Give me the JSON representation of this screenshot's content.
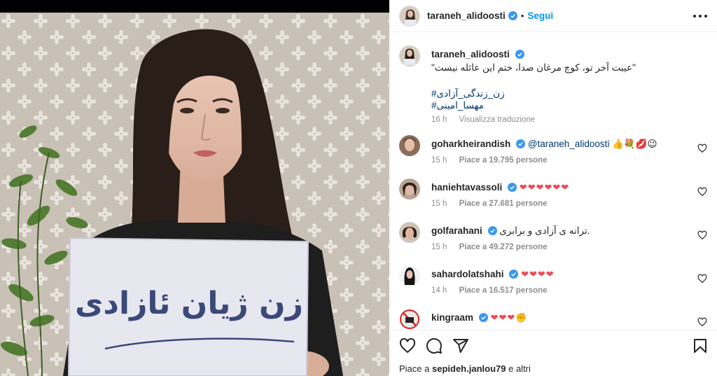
{
  "post": {
    "author": "taraneh_alidoosti",
    "follow_label": "Segui",
    "separator": "•",
    "sign_text": "زن ژیان ئازادی"
  },
  "caption": {
    "username": "taraneh_alidoosti",
    "text": "\"عیبت آخر تو، کوچ مرغان صدا، ختم این عائله نیست\"",
    "hashtags": [
      "#زن_زندگی_آزادی",
      "#مهسا_امینی"
    ],
    "time": "16 h",
    "translate_label": "Visualizza traduzione"
  },
  "comments": [
    {
      "username": "goharkheirandish",
      "mention": "@taraneh_alidoosti",
      "text": "",
      "emoji": "👍💐💋😉",
      "time": "15 h",
      "likes": "Piace a 19.795 persone"
    },
    {
      "username": "haniehtavassoli",
      "mention": "",
      "text": "",
      "emoji": "❤❤❤❤❤❤",
      "time": "15 h",
      "likes": "Piace a 27.681 persone"
    },
    {
      "username": "golfarahani",
      "mention": "",
      "text": "ترانه ی آزادی و برابری.",
      "emoji": "",
      "time": "15 h",
      "likes": "Piace a 49.272 persone"
    },
    {
      "username": "sahardolatshahi",
      "mention": "",
      "text": "",
      "emoji": "❤❤❤❤",
      "time": "14 h",
      "likes": "Piace a 16.517 persone"
    },
    {
      "username": "kingraam",
      "mention": "",
      "text": "",
      "emoji": "❤❤❤✊",
      "time": "",
      "likes": ""
    }
  ],
  "footer": {
    "likes_prefix": "Piace a",
    "likes_user": "sepideh.janlou79",
    "likes_suffix": "e altri"
  },
  "colors": {
    "link_blue": "#0095f6",
    "verified_blue": "#3897f0",
    "heart_red": "#ed4956",
    "meta_gray": "#8e8e8e"
  },
  "icons": [
    "verified-badge-icon",
    "more-options-icon",
    "like-heart-icon",
    "comment-icon",
    "share-icon",
    "save-bookmark-icon"
  ]
}
